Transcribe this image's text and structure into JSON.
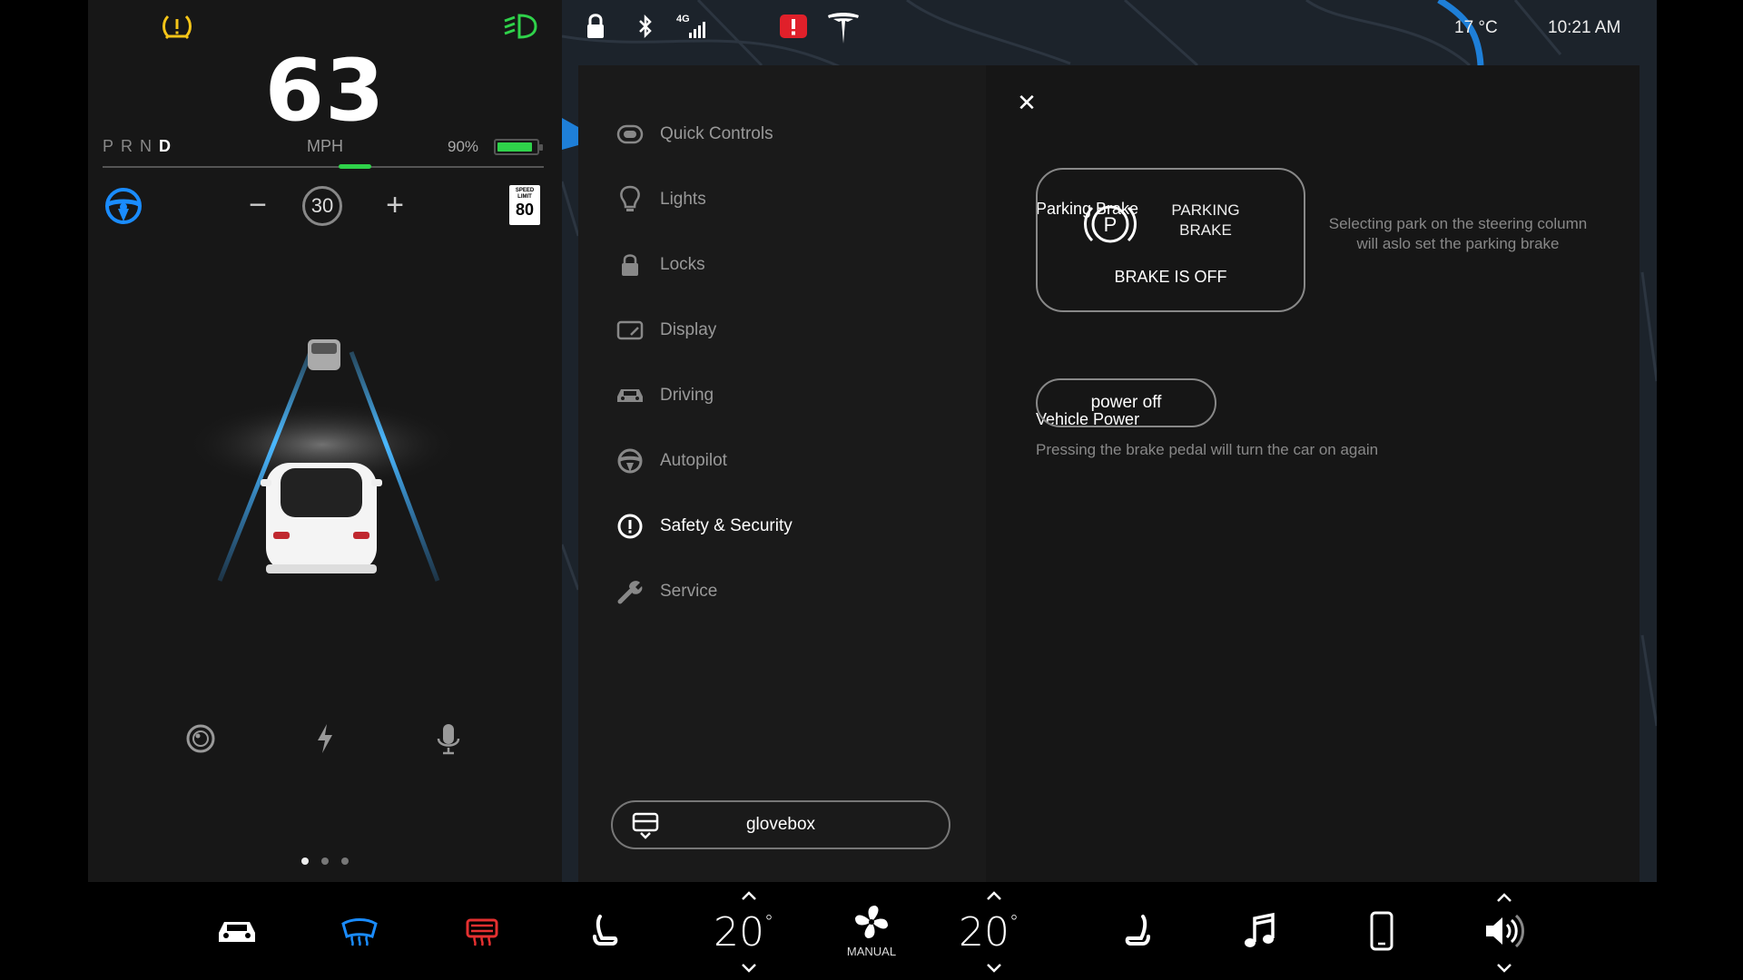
{
  "cluster": {
    "speed": "63",
    "gears": [
      "P",
      "R",
      "N",
      "D"
    ],
    "active_gear": "D",
    "speed_unit": "MPH",
    "battery_pct": "90%",
    "set_speed": "30",
    "minus_label": "−",
    "plus_label": "+",
    "speed_limit_label": "SPEED LIMIT",
    "speed_limit_value": "80",
    "page_dots": 3,
    "active_page_dot": 0
  },
  "status": {
    "network": "4G",
    "temperature": "17 °C",
    "time": "10:21 AM"
  },
  "menu": {
    "items": [
      {
        "label": "Quick Controls",
        "icon": "toggle-icon"
      },
      {
        "label": "Lights",
        "icon": "bulb-icon"
      },
      {
        "label": "Locks",
        "icon": "lock-icon"
      },
      {
        "label": "Display",
        "icon": "display-icon"
      },
      {
        "label": "Driving",
        "icon": "car-icon"
      },
      {
        "label": "Autopilot",
        "icon": "steering-wheel-icon"
      },
      {
        "label": "Safety & Security",
        "icon": "alert-circle-icon"
      },
      {
        "label": "Service",
        "icon": "wrench-icon"
      }
    ],
    "active_index": 6,
    "glovebox_label": "glovebox"
  },
  "panel": {
    "close_label": "✕",
    "parking_brake_title": "Parking Brake",
    "parking_brake_label": "PARKING BRAKE",
    "parking_brake_state": "BRAKE IS OFF",
    "parking_brake_hint": "Selecting park on the steering column will aslo set the parking brake",
    "vehicle_power_title": "Vehicle Power",
    "power_off_label": "power off",
    "power_hint": "Pressing the brake pedal will turn the car on again"
  },
  "climate": {
    "driver_temp": "20",
    "passenger_temp": "20",
    "degree_symbol": "°",
    "fan_mode": "MANUAL"
  },
  "colors": {
    "accent_blue": "#1a8cff",
    "battery_green": "#2fd24a",
    "warning_yellow": "#f5c518",
    "alert_red": "#e0202a",
    "defrost_red": "#e53030"
  }
}
